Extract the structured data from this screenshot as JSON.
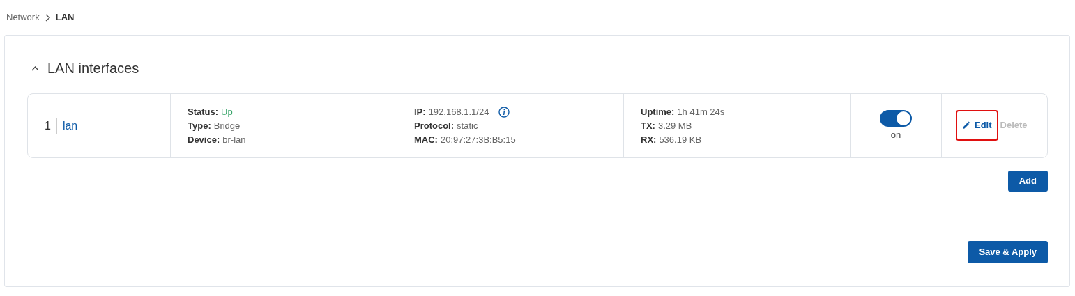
{
  "breadcrumb": [
    {
      "label": "Network",
      "current": false
    },
    {
      "label": "LAN",
      "current": true
    }
  ],
  "section": {
    "title": "LAN interfaces",
    "expanded": true
  },
  "interfaces": [
    {
      "index": "1",
      "name": "lan",
      "groups": [
        [
          {
            "label": "Status:",
            "value": "Up",
            "color": "#3aa56b"
          },
          {
            "label": "Type:",
            "value": "Bridge"
          },
          {
            "label": "Device:",
            "value": "br-lan"
          }
        ],
        [
          {
            "label": "IP:",
            "value": "192.168.1.1/24",
            "info": true
          },
          {
            "label": "Protocol:",
            "value": "static"
          },
          {
            "label": "MAC:",
            "value": "20:97:27:3B:B5:15"
          }
        ],
        [
          {
            "label": "Uptime:",
            "value": "1h 41m 24s"
          },
          {
            "label": "TX:",
            "value": "3.29 MB"
          },
          {
            "label": "RX:",
            "value": "536.19 KB"
          }
        ]
      ],
      "toggle": {
        "on": true,
        "label": "on"
      },
      "actions": [
        {
          "label": "Edit",
          "kind": "edit",
          "disabled": false,
          "highlighted": true
        },
        {
          "label": "Delete",
          "kind": "delete",
          "disabled": true,
          "highlighted": false
        }
      ]
    }
  ],
  "buttons": {
    "add": "Add",
    "save": "Save & Apply"
  }
}
